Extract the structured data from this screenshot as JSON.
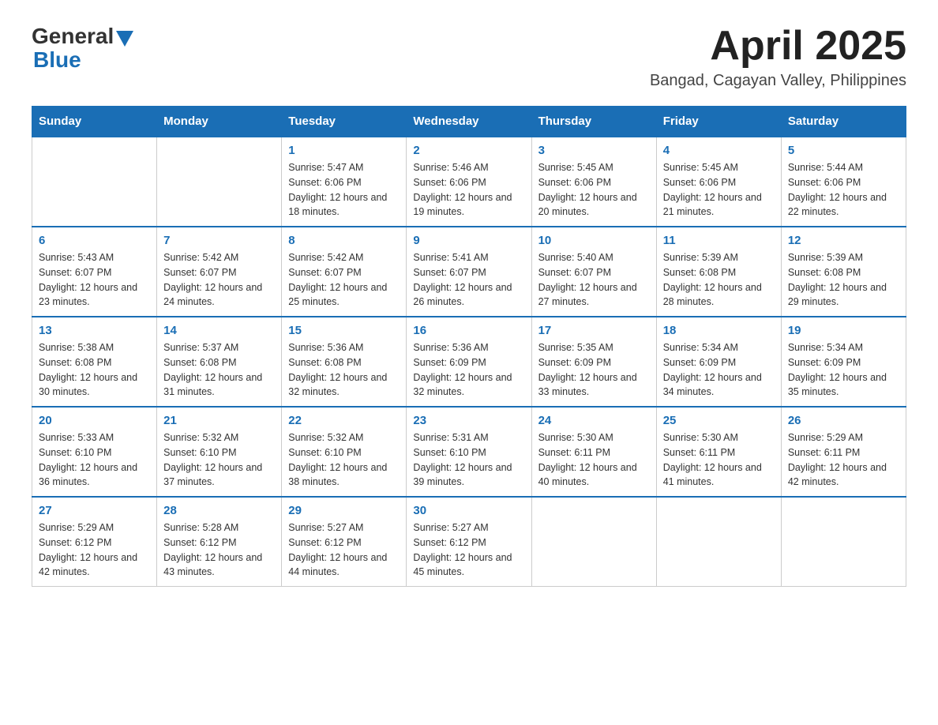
{
  "header": {
    "logo_general": "General",
    "logo_blue": "Blue",
    "title": "April 2025",
    "subtitle": "Bangad, Cagayan Valley, Philippines"
  },
  "calendar": {
    "days_of_week": [
      "Sunday",
      "Monday",
      "Tuesday",
      "Wednesday",
      "Thursday",
      "Friday",
      "Saturday"
    ],
    "weeks": [
      [
        {
          "day": "",
          "sunrise": "",
          "sunset": "",
          "daylight": ""
        },
        {
          "day": "",
          "sunrise": "",
          "sunset": "",
          "daylight": ""
        },
        {
          "day": "1",
          "sunrise": "Sunrise: 5:47 AM",
          "sunset": "Sunset: 6:06 PM",
          "daylight": "Daylight: 12 hours and 18 minutes."
        },
        {
          "day": "2",
          "sunrise": "Sunrise: 5:46 AM",
          "sunset": "Sunset: 6:06 PM",
          "daylight": "Daylight: 12 hours and 19 minutes."
        },
        {
          "day": "3",
          "sunrise": "Sunrise: 5:45 AM",
          "sunset": "Sunset: 6:06 PM",
          "daylight": "Daylight: 12 hours and 20 minutes."
        },
        {
          "day": "4",
          "sunrise": "Sunrise: 5:45 AM",
          "sunset": "Sunset: 6:06 PM",
          "daylight": "Daylight: 12 hours and 21 minutes."
        },
        {
          "day": "5",
          "sunrise": "Sunrise: 5:44 AM",
          "sunset": "Sunset: 6:06 PM",
          "daylight": "Daylight: 12 hours and 22 minutes."
        }
      ],
      [
        {
          "day": "6",
          "sunrise": "Sunrise: 5:43 AM",
          "sunset": "Sunset: 6:07 PM",
          "daylight": "Daylight: 12 hours and 23 minutes."
        },
        {
          "day": "7",
          "sunrise": "Sunrise: 5:42 AM",
          "sunset": "Sunset: 6:07 PM",
          "daylight": "Daylight: 12 hours and 24 minutes."
        },
        {
          "day": "8",
          "sunrise": "Sunrise: 5:42 AM",
          "sunset": "Sunset: 6:07 PM",
          "daylight": "Daylight: 12 hours and 25 minutes."
        },
        {
          "day": "9",
          "sunrise": "Sunrise: 5:41 AM",
          "sunset": "Sunset: 6:07 PM",
          "daylight": "Daylight: 12 hours and 26 minutes."
        },
        {
          "day": "10",
          "sunrise": "Sunrise: 5:40 AM",
          "sunset": "Sunset: 6:07 PM",
          "daylight": "Daylight: 12 hours and 27 minutes."
        },
        {
          "day": "11",
          "sunrise": "Sunrise: 5:39 AM",
          "sunset": "Sunset: 6:08 PM",
          "daylight": "Daylight: 12 hours and 28 minutes."
        },
        {
          "day": "12",
          "sunrise": "Sunrise: 5:39 AM",
          "sunset": "Sunset: 6:08 PM",
          "daylight": "Daylight: 12 hours and 29 minutes."
        }
      ],
      [
        {
          "day": "13",
          "sunrise": "Sunrise: 5:38 AM",
          "sunset": "Sunset: 6:08 PM",
          "daylight": "Daylight: 12 hours and 30 minutes."
        },
        {
          "day": "14",
          "sunrise": "Sunrise: 5:37 AM",
          "sunset": "Sunset: 6:08 PM",
          "daylight": "Daylight: 12 hours and 31 minutes."
        },
        {
          "day": "15",
          "sunrise": "Sunrise: 5:36 AM",
          "sunset": "Sunset: 6:08 PM",
          "daylight": "Daylight: 12 hours and 32 minutes."
        },
        {
          "day": "16",
          "sunrise": "Sunrise: 5:36 AM",
          "sunset": "Sunset: 6:09 PM",
          "daylight": "Daylight: 12 hours and 32 minutes."
        },
        {
          "day": "17",
          "sunrise": "Sunrise: 5:35 AM",
          "sunset": "Sunset: 6:09 PM",
          "daylight": "Daylight: 12 hours and 33 minutes."
        },
        {
          "day": "18",
          "sunrise": "Sunrise: 5:34 AM",
          "sunset": "Sunset: 6:09 PM",
          "daylight": "Daylight: 12 hours and 34 minutes."
        },
        {
          "day": "19",
          "sunrise": "Sunrise: 5:34 AM",
          "sunset": "Sunset: 6:09 PM",
          "daylight": "Daylight: 12 hours and 35 minutes."
        }
      ],
      [
        {
          "day": "20",
          "sunrise": "Sunrise: 5:33 AM",
          "sunset": "Sunset: 6:10 PM",
          "daylight": "Daylight: 12 hours and 36 minutes."
        },
        {
          "day": "21",
          "sunrise": "Sunrise: 5:32 AM",
          "sunset": "Sunset: 6:10 PM",
          "daylight": "Daylight: 12 hours and 37 minutes."
        },
        {
          "day": "22",
          "sunrise": "Sunrise: 5:32 AM",
          "sunset": "Sunset: 6:10 PM",
          "daylight": "Daylight: 12 hours and 38 minutes."
        },
        {
          "day": "23",
          "sunrise": "Sunrise: 5:31 AM",
          "sunset": "Sunset: 6:10 PM",
          "daylight": "Daylight: 12 hours and 39 minutes."
        },
        {
          "day": "24",
          "sunrise": "Sunrise: 5:30 AM",
          "sunset": "Sunset: 6:11 PM",
          "daylight": "Daylight: 12 hours and 40 minutes."
        },
        {
          "day": "25",
          "sunrise": "Sunrise: 5:30 AM",
          "sunset": "Sunset: 6:11 PM",
          "daylight": "Daylight: 12 hours and 41 minutes."
        },
        {
          "day": "26",
          "sunrise": "Sunrise: 5:29 AM",
          "sunset": "Sunset: 6:11 PM",
          "daylight": "Daylight: 12 hours and 42 minutes."
        }
      ],
      [
        {
          "day": "27",
          "sunrise": "Sunrise: 5:29 AM",
          "sunset": "Sunset: 6:12 PM",
          "daylight": "Daylight: 12 hours and 42 minutes."
        },
        {
          "day": "28",
          "sunrise": "Sunrise: 5:28 AM",
          "sunset": "Sunset: 6:12 PM",
          "daylight": "Daylight: 12 hours and 43 minutes."
        },
        {
          "day": "29",
          "sunrise": "Sunrise: 5:27 AM",
          "sunset": "Sunset: 6:12 PM",
          "daylight": "Daylight: 12 hours and 44 minutes."
        },
        {
          "day": "30",
          "sunrise": "Sunrise: 5:27 AM",
          "sunset": "Sunset: 6:12 PM",
          "daylight": "Daylight: 12 hours and 45 minutes."
        },
        {
          "day": "",
          "sunrise": "",
          "sunset": "",
          "daylight": ""
        },
        {
          "day": "",
          "sunrise": "",
          "sunset": "",
          "daylight": ""
        },
        {
          "day": "",
          "sunrise": "",
          "sunset": "",
          "daylight": ""
        }
      ]
    ]
  }
}
